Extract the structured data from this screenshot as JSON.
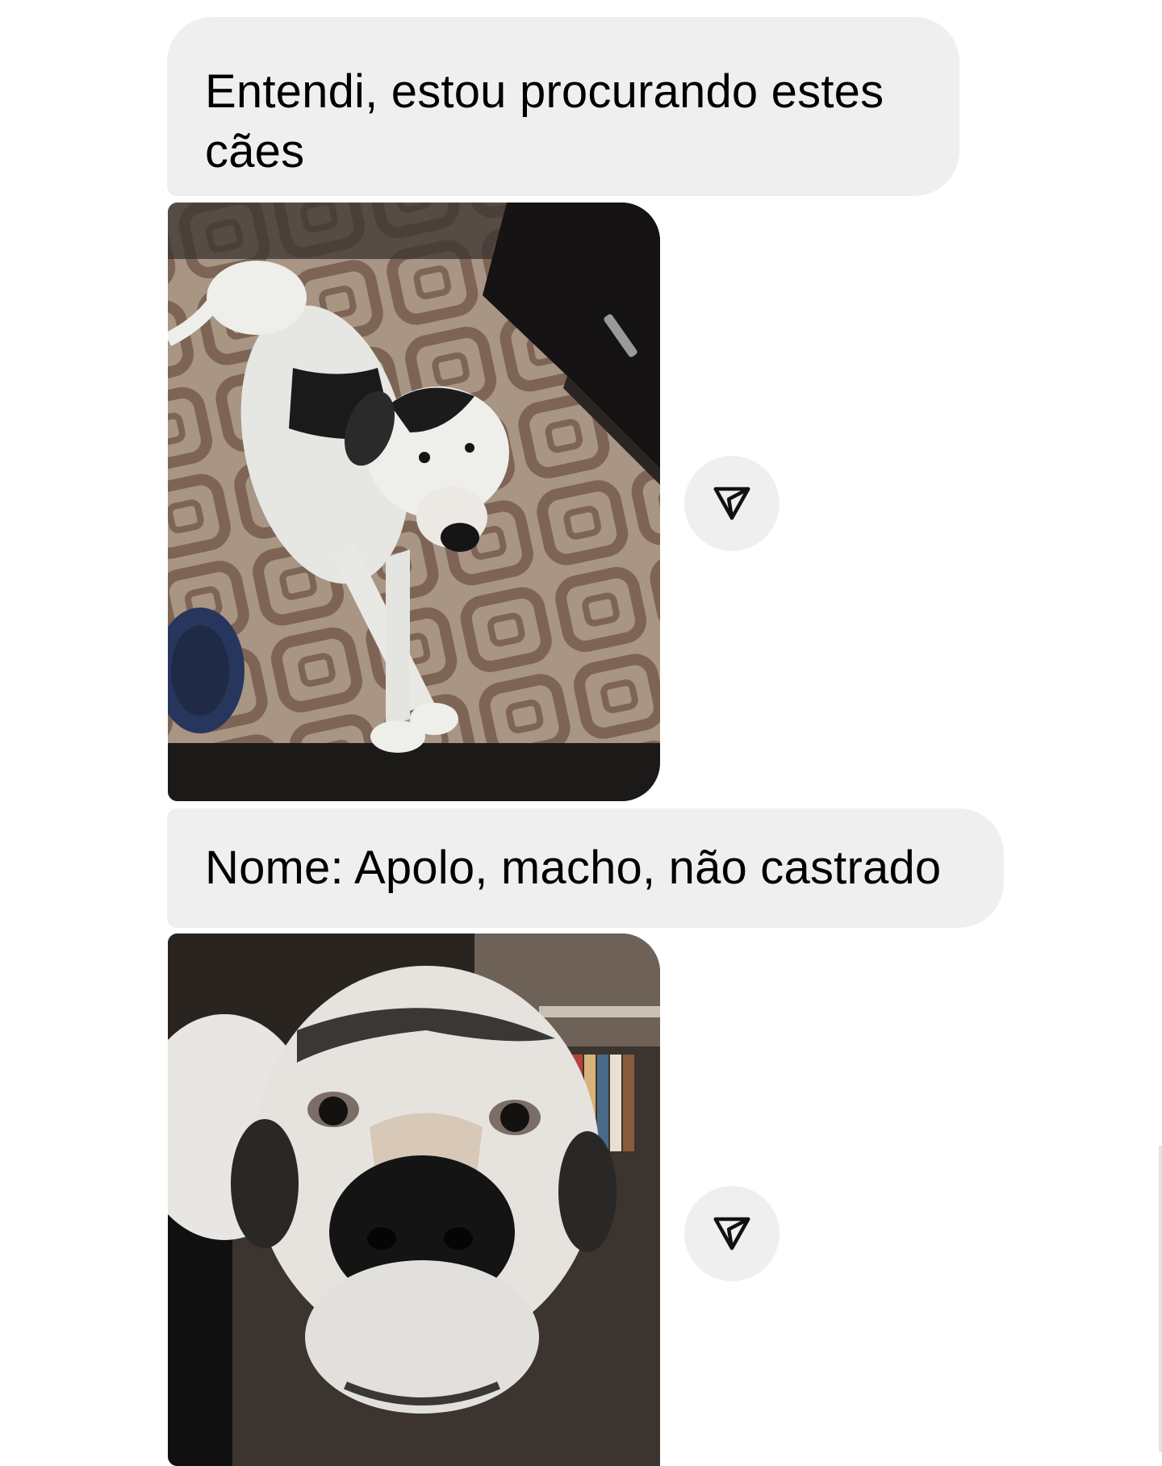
{
  "messages": [
    {
      "type": "text",
      "text": "Entendi, estou procurando estes cães"
    },
    {
      "type": "image",
      "description_icon": "dog-photo-lying-on-rug",
      "action_icon": "share-icon"
    },
    {
      "type": "text",
      "text": "Nome: Apolo, macho, não castrado"
    },
    {
      "type": "image",
      "description_icon": "dog-photo-closeup",
      "action_icon": "share-icon"
    }
  ],
  "colors": {
    "bubble_bg": "#efefef",
    "text": "#000000",
    "page_bg": "#ffffff"
  }
}
